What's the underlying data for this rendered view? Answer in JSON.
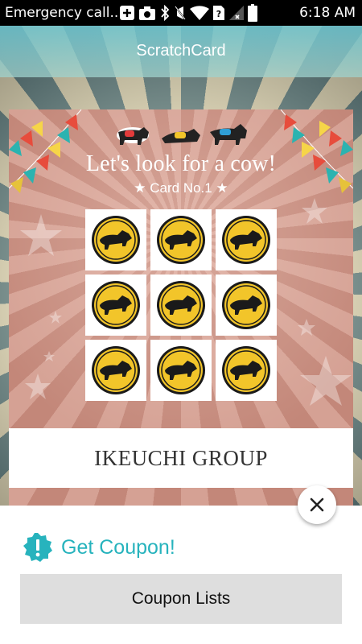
{
  "status_bar": {
    "carrier": "Emergency call...",
    "time": "6:18 AM",
    "icons": [
      "add-icon",
      "camera-icon",
      "bluetooth-icon",
      "mute-icon",
      "wifi-icon",
      "unknown-sim-icon",
      "signal-icon",
      "battery-icon"
    ]
  },
  "app_bar": {
    "title": "ScratchCard"
  },
  "card": {
    "heading": "Let's look for a cow!",
    "card_number": "★  Card No.1  ★",
    "grid_icon": "cow-coin-icon",
    "grid_count": 9,
    "brand": "IKEUCHI GROUP"
  },
  "sheet": {
    "coupon_label": "Get Coupon!",
    "coupon_lists_label": "Coupon Lists"
  },
  "colors": {
    "accent": "#27b3bd",
    "app_bar": "#70c8d2",
    "coin_yellow": "#f2c52a",
    "card_bg": "#c38779"
  }
}
